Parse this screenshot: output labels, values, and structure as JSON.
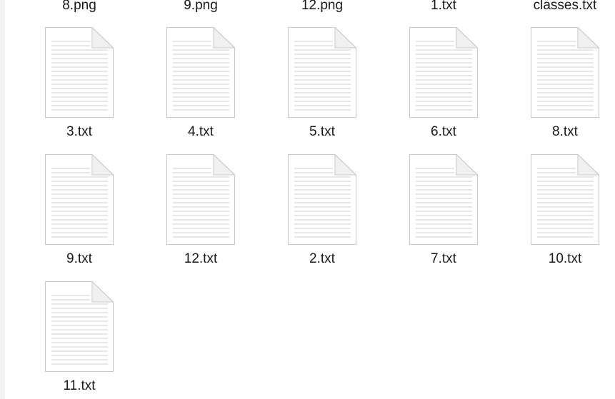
{
  "top_row_labels": [
    "8.png",
    "9.png",
    "12.png",
    "1.txt",
    "classes.txt"
  ],
  "files": [
    {
      "name": "3.txt",
      "icon": "text-document-icon"
    },
    {
      "name": "4.txt",
      "icon": "text-document-icon"
    },
    {
      "name": "5.txt",
      "icon": "text-document-icon"
    },
    {
      "name": "6.txt",
      "icon": "text-document-icon"
    },
    {
      "name": "8.txt",
      "icon": "text-document-icon"
    },
    {
      "name": "9.txt",
      "icon": "text-document-icon"
    },
    {
      "name": "12.txt",
      "icon": "text-document-icon"
    },
    {
      "name": "2.txt",
      "icon": "text-document-icon"
    },
    {
      "name": "7.txt",
      "icon": "text-document-icon"
    },
    {
      "name": "10.txt",
      "icon": "text-document-icon"
    },
    {
      "name": "11.txt",
      "icon": "text-document-icon"
    }
  ],
  "colors": {
    "page_bg": "#ffffff",
    "label_text": "#1a1a1a",
    "icon_border": "#c8c8c8",
    "icon_lines": "#cfcfcf"
  }
}
